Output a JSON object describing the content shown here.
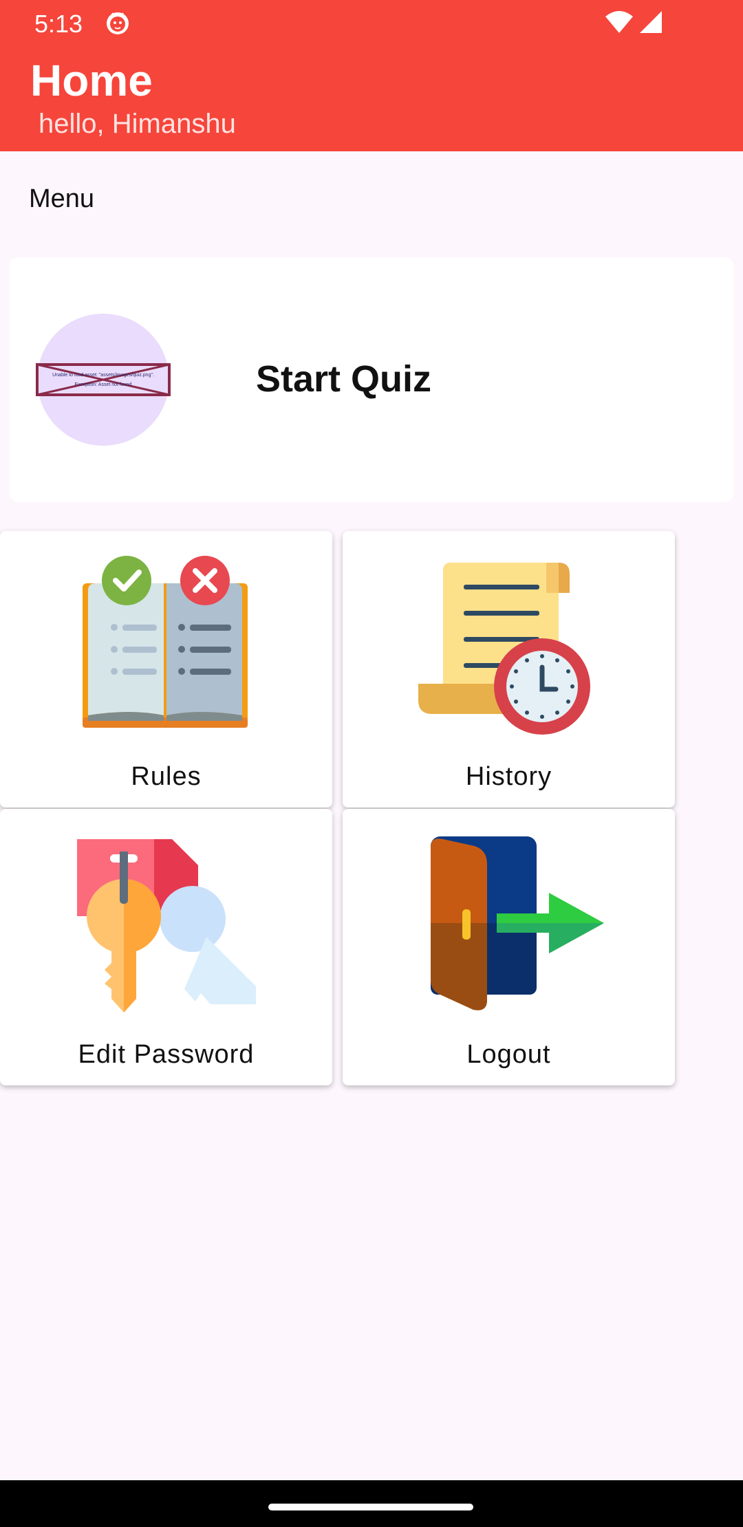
{
  "status_bar": {
    "time": "5:13",
    "app_icon": "cat-notification-icon",
    "wifi_icon": "wifi-icon",
    "signal_icon": "cell-signal-icon"
  },
  "app_bar": {
    "title": "Home",
    "subtitle": "hello, Himanshu",
    "color": "#f6453b"
  },
  "menu": {
    "label": "Menu"
  },
  "quiz_card": {
    "title": "Start Quiz",
    "broken_image_line1": "Unable to load asset: \"assets/images/quiz.png\".",
    "broken_image_line2": "Exception: Asset not found",
    "avatar_color": "#eadcfc"
  },
  "tiles": [
    {
      "label": "Rules",
      "icon": "rules-book-icon"
    },
    {
      "label": "History",
      "icon": "history-scroll-clock-icon"
    },
    {
      "label": "Edit Password",
      "icon": "keys-icon"
    },
    {
      "label": "Logout",
      "icon": "logout-door-icon"
    }
  ],
  "colors": {
    "background": "#fdf7fd",
    "accent": "#f6453b"
  }
}
